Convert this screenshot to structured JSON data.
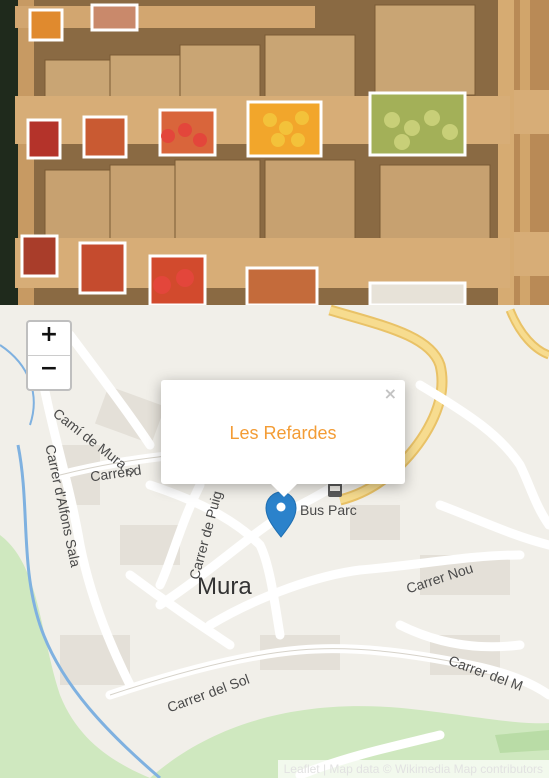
{
  "map": {
    "zoom_in_label": "+",
    "zoom_out_label": "−",
    "popup": {
      "title": "Les Refardes",
      "close_label": "×"
    },
    "labels": {
      "cami_de_mura": "Camí de Mura a",
      "carrer_d": "Carrer d",
      "carrer_alfons_sala": "Carrer d'Alfons Sala",
      "carrer_de_puig": "Carrer de Puig",
      "bus_parc": "Bus Parc",
      "town": "Mura",
      "carrer_nou": "Carrer Nou",
      "carrer_del_sol": "Carrer del Sol",
      "carrer_del_m": "Carrer del M"
    },
    "attribution": "Leaflet | Map data © Wikimedia Map contributors"
  }
}
